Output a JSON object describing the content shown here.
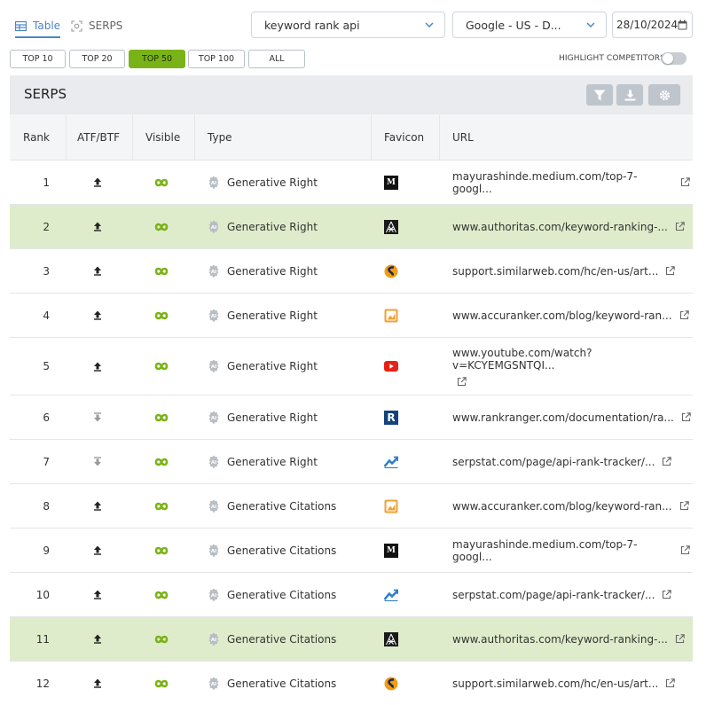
{
  "view_tabs": {
    "table": "Table",
    "serps": "SERPS"
  },
  "keyword_select": {
    "value": "keyword rank api"
  },
  "engine_select": {
    "value": "Google - US - D..."
  },
  "date": {
    "value": "28/10/2024"
  },
  "filters": [
    "TOP 10",
    "TOP 20",
    "TOP 50",
    "TOP 100",
    "ALL"
  ],
  "active_filter": "TOP 50",
  "highlight_competitors": {
    "label": "HIGHLIGHT COMPETITORS",
    "on": false
  },
  "panel": {
    "title": "SERPS"
  },
  "columns": {
    "rank": "Rank",
    "atf": "ATF/BTF",
    "visible": "Visible",
    "type": "Type",
    "favicon": "Favicon",
    "url": "URL"
  },
  "colors": {
    "accent": "#4a86c8",
    "active_filter": "#7ab317",
    "highlight_row": "#dfeccb",
    "visible_icon": "#7ab317"
  },
  "rows": [
    {
      "rank": "1",
      "atf": "above",
      "type": "Generative Right",
      "favicon": "medium-icon",
      "url": "mayurashinde.medium.com/top-7-googl...",
      "highlight": false
    },
    {
      "rank": "2",
      "atf": "above",
      "type": "Generative Right",
      "favicon": "authoritas-icon",
      "url": "www.authoritas.com/keyword-ranking-...",
      "highlight": true
    },
    {
      "rank": "3",
      "atf": "above",
      "type": "Generative Right",
      "favicon": "similarweb-icon",
      "url": "support.similarweb.com/hc/en-us/art...",
      "highlight": false
    },
    {
      "rank": "4",
      "atf": "above",
      "type": "Generative Right",
      "favicon": "accuranker-icon",
      "url": "www.accuranker.com/blog/keyword-ran...",
      "highlight": false
    },
    {
      "rank": "5",
      "atf": "above",
      "type": "Generative Right",
      "favicon": "youtube-icon",
      "url": "www.youtube.com/watch?v=KCYEMGSNTQI...",
      "highlight": false
    },
    {
      "rank": "6",
      "atf": "below",
      "type": "Generative Right",
      "favicon": "rankranger-icon",
      "url": "www.rankranger.com/documentation/ra...",
      "highlight": false
    },
    {
      "rank": "7",
      "atf": "below",
      "type": "Generative Right",
      "favicon": "serpstat-icon",
      "url": "serpstat.com/page/api-rank-tracker/...",
      "highlight": false
    },
    {
      "rank": "8",
      "atf": "above",
      "type": "Generative Citations",
      "favicon": "accuranker-icon",
      "url": "www.accuranker.com/blog/keyword-ran...",
      "highlight": false
    },
    {
      "rank": "9",
      "atf": "above",
      "type": "Generative Citations",
      "favicon": "medium-icon",
      "url": "mayurashinde.medium.com/top-7-googl...",
      "highlight": false
    },
    {
      "rank": "10",
      "atf": "above",
      "type": "Generative Citations",
      "favicon": "serpstat-icon",
      "url": "serpstat.com/page/api-rank-tracker/...",
      "highlight": false
    },
    {
      "rank": "11",
      "atf": "above",
      "type": "Generative Citations",
      "favicon": "authoritas-icon",
      "url": "www.authoritas.com/keyword-ranking-...",
      "highlight": true
    },
    {
      "rank": "12",
      "atf": "above",
      "type": "Generative Citations",
      "favicon": "similarweb-icon",
      "url": "support.similarweb.com/hc/en-us/art...",
      "highlight": false
    }
  ]
}
